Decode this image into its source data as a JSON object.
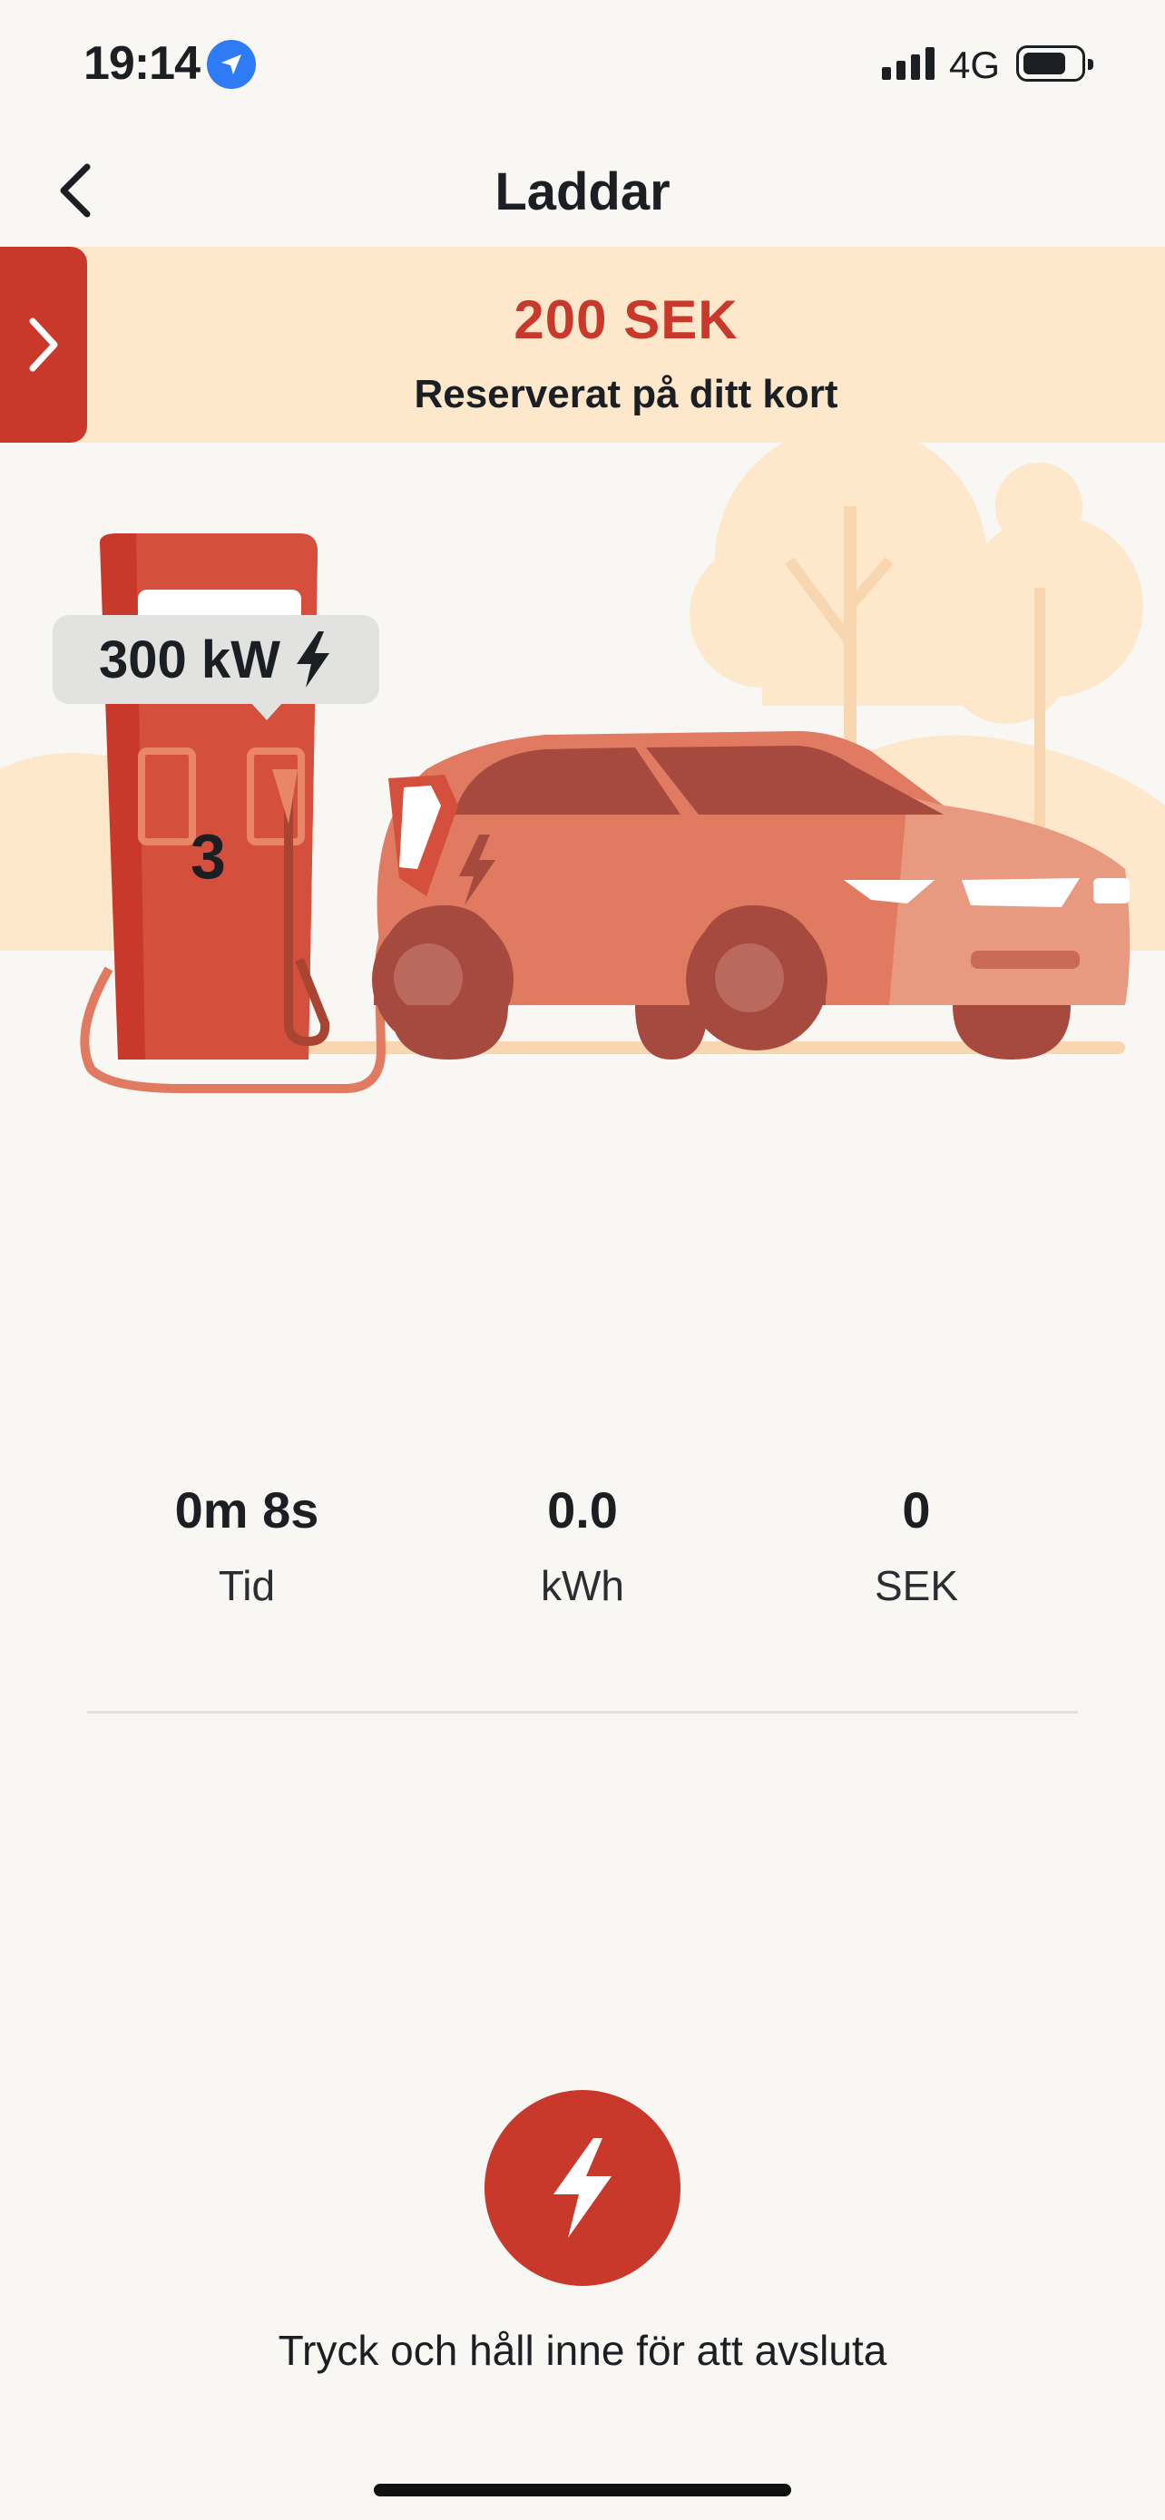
{
  "status_bar": {
    "time": "19:14",
    "network": "4G",
    "icons": [
      "location-arrow-icon",
      "signal-icon",
      "battery-icon"
    ]
  },
  "header": {
    "title": "Laddar",
    "back_icon": "chevron-left-icon"
  },
  "reservation": {
    "amount": "200 SEK",
    "subtitle": "Reserverat på ditt kort",
    "expand_icon": "chevron-right-icon"
  },
  "charger": {
    "power": "300 kW",
    "power_icon": "bolt-icon",
    "number": "3"
  },
  "stats": [
    {
      "value": "0m 8s",
      "label": "Tid"
    },
    {
      "value": "0.0",
      "label": "kWh"
    },
    {
      "value": "0",
      "label": "SEK"
    }
  ],
  "stop": {
    "hint": "Tryck och håll inne för att avsluta",
    "icon": "bolt-icon"
  },
  "colors": {
    "accent": "#c9392b",
    "banner_bg": "#fde8cc",
    "background": "#f9f7f3",
    "car": "#e07b62"
  }
}
